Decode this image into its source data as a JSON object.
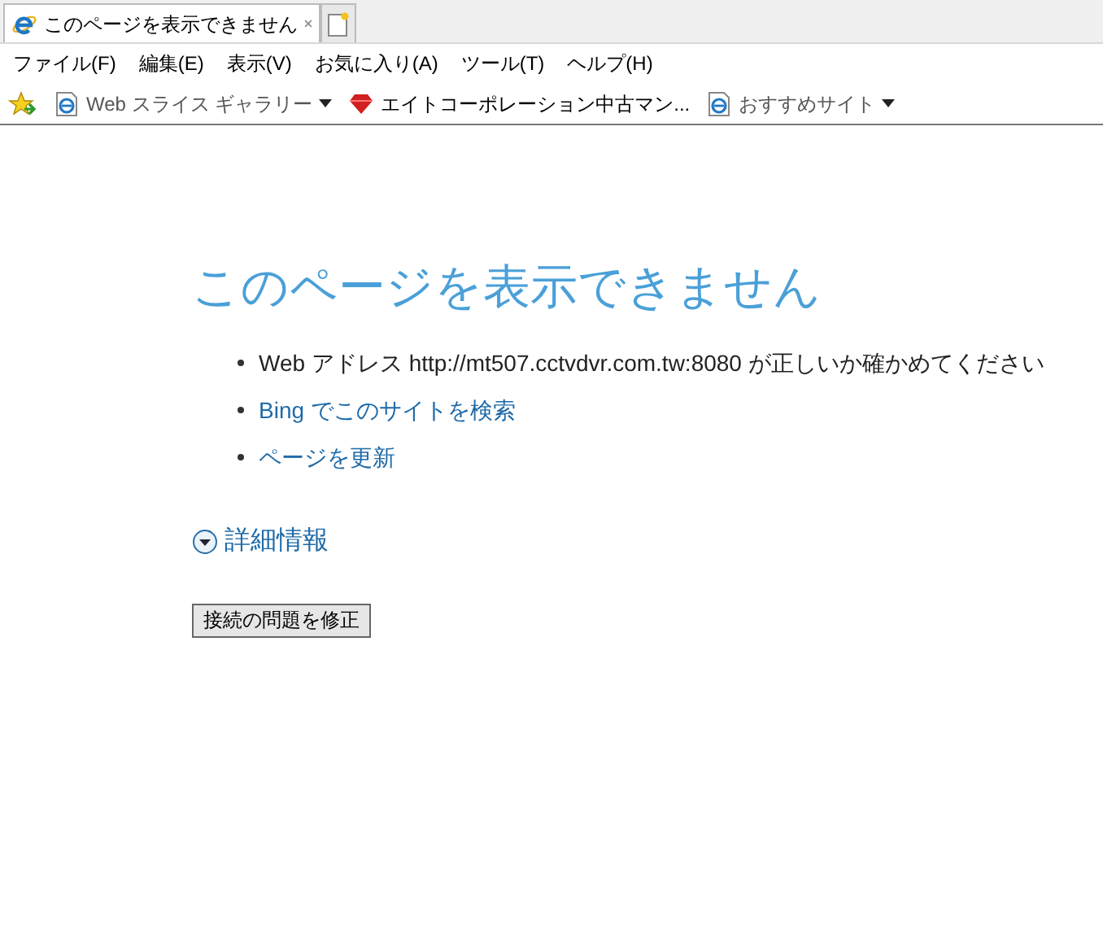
{
  "tabs": [
    {
      "title": "このページを表示できません",
      "selected": true
    }
  ],
  "menu_bar": [
    "ファイル(F)",
    "編集(E)",
    "表示(V)",
    "お気に入り(A)",
    "ツール(T)",
    "ヘルプ(H)"
  ],
  "favorites_bar": [
    {
      "label": "Web スライス ギャラリー",
      "kind": "page",
      "has_dropdown": true
    },
    {
      "label": "エイトコーポレーション中古マン...",
      "kind": "gem",
      "has_dropdown": false
    },
    {
      "label": "おすすめサイト",
      "kind": "page",
      "has_dropdown": true
    }
  ],
  "page": {
    "heading": "このページを表示できません",
    "suggestions": [
      {
        "kind": "text",
        "text": "Web アドレス http://mt507.cctvdvr.com.tw:8080 が正しいか確かめてください"
      },
      {
        "kind": "link",
        "text": "Bing でこのサイトを検索"
      },
      {
        "kind": "link",
        "text": "ページを更新"
      }
    ],
    "details_link": "詳細情報",
    "fix_button": "接続の問題を修正"
  }
}
